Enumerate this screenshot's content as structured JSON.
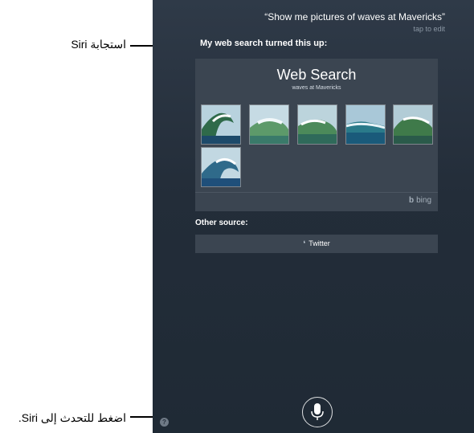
{
  "siri": {
    "query_text": "“Show me pictures of waves at Mavericks”",
    "tap_to_edit": "tap to edit",
    "response_text": "My web search turned this up:"
  },
  "web_search": {
    "title": "Web Search",
    "subtitle": "waves at Mavericks",
    "images": [
      "wave-image",
      "wave-image",
      "wave-image",
      "wave-image",
      "wave-image",
      "wave-image"
    ],
    "provider": "bing"
  },
  "other_source": {
    "label": "Other source:",
    "button_label": "Twitter"
  },
  "callouts": {
    "siri_response": "استجابة Siri",
    "tap_to_speak": "اضغط للتحدث إلى Siri."
  },
  "icons": {
    "help": "?",
    "bing_glyph": "b",
    "twitter_glyph": "❛"
  },
  "colors": {
    "background": "#232d39",
    "card": "#3b4551",
    "text": "#ffffff"
  }
}
